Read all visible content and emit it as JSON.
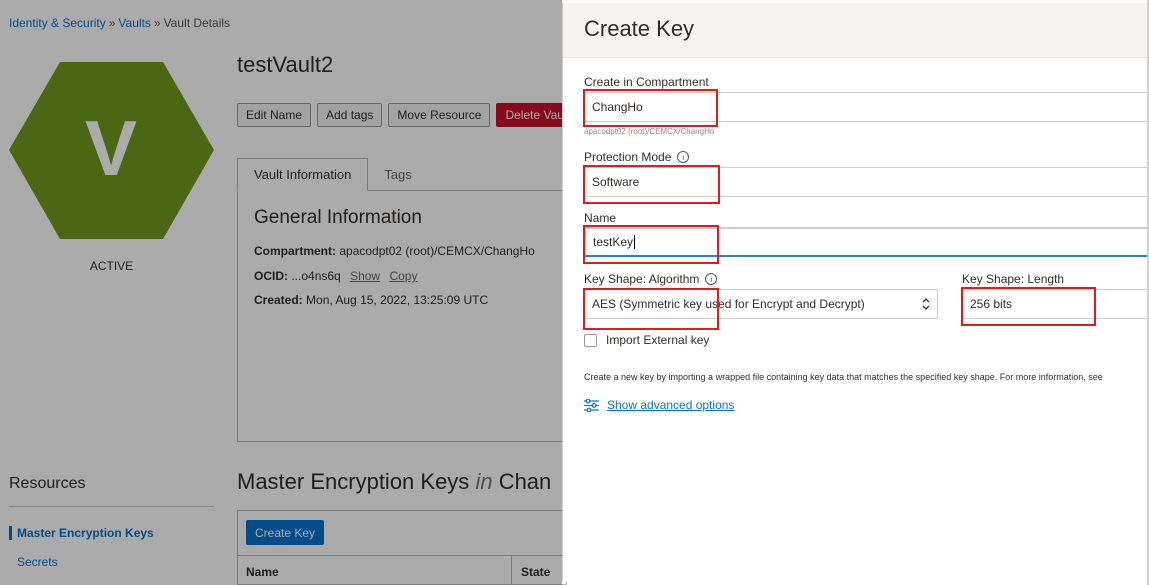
{
  "breadcrumb": {
    "items": [
      "Identity & Security",
      "Vaults"
    ],
    "current": "Vault Details",
    "separator": "»"
  },
  "vault": {
    "icon_letter": "V",
    "status": "ACTIVE",
    "title": "testVault2",
    "hex_color": "#6f9a1f"
  },
  "actions": {
    "edit_name": "Edit Name",
    "add_tags": "Add tags",
    "move_resource": "Move Resource",
    "delete_vault": "Delete Vault"
  },
  "tabs": {
    "vault_information": "Vault Information",
    "tags": "Tags"
  },
  "general_info": {
    "title": "General Information",
    "compartment_label": "Compartment:",
    "compartment_value": "apacodpt02 (root)/CEMCX/ChangHo",
    "ocid_label": "OCID:",
    "ocid_value": "...o4ns6q",
    "show_link": "Show",
    "copy_link": "Copy",
    "created_label": "Created:",
    "created_value": "Mon, Aug 15, 2022, 13:25:09 UTC"
  },
  "resources": {
    "title": "Resources",
    "items": [
      "Master Encryption Keys",
      "Secrets"
    ]
  },
  "keys_section": {
    "title_main": "Master Encryption Keys",
    "title_in": "in",
    "title_compartment": "Chan",
    "create_button": "Create Key",
    "columns": [
      "Name",
      "State"
    ]
  },
  "panel": {
    "title": "Create Key",
    "compartment_label": "Create in Compartment",
    "compartment_value": "ChangHo",
    "compartment_path": "apacodpt02 (root)/CEMCX/ChangHo",
    "protection_label": "Protection Mode",
    "protection_value": "Software",
    "name_label": "Name",
    "name_value": "testKey",
    "algorithm_label": "Key Shape: Algorithm",
    "algorithm_value": "AES (Symmetric key used for Encrypt and Decrypt)",
    "length_label": "Key Shape: Length",
    "length_value": "256 bits",
    "import_label": "Import External key",
    "import_checked": false,
    "help_text": "Create a new key by importing a wrapped file containing key data that matches the specified key shape. For more information, see",
    "advanced_link": "Show advanced options"
  },
  "colors": {
    "accent": "#0572ce",
    "danger": "#c70f2b",
    "highlight": "#e01b22"
  }
}
